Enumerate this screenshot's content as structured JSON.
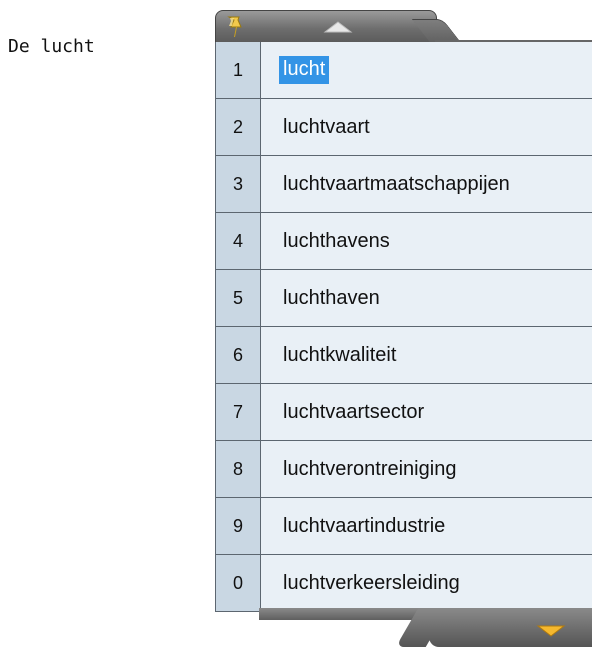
{
  "editor": {
    "text": "De lucht"
  },
  "popup": {
    "pin_icon": "pushpin-icon",
    "scroll_up_icon": "triangle-up-icon",
    "scroll_down_icon": "triangle-down-icon",
    "selected_index": 0,
    "suggestions": [
      {
        "key": "1",
        "word": "lucht"
      },
      {
        "key": "2",
        "word": "luchtvaart"
      },
      {
        "key": "3",
        "word": "luchtvaartmaatschappijen"
      },
      {
        "key": "4",
        "word": "luchthavens"
      },
      {
        "key": "5",
        "word": "luchthaven"
      },
      {
        "key": "6",
        "word": "luchtkwaliteit"
      },
      {
        "key": "7",
        "word": "luchtvaartsector"
      },
      {
        "key": "8",
        "word": "luchtverontreiniging"
      },
      {
        "key": "9",
        "word": "luchtvaartindustrie"
      },
      {
        "key": "0",
        "word": "luchtverkeersleiding"
      }
    ]
  },
  "colors": {
    "selection_bg": "#3394e6",
    "number_column_bg": "#c9d7e3",
    "word_column_bg": "#e9f0f6",
    "frame_gray": "#6e6e6e",
    "pin_yellow": "#f2c94c",
    "down_arrow_yellow": "#f5b82e"
  }
}
